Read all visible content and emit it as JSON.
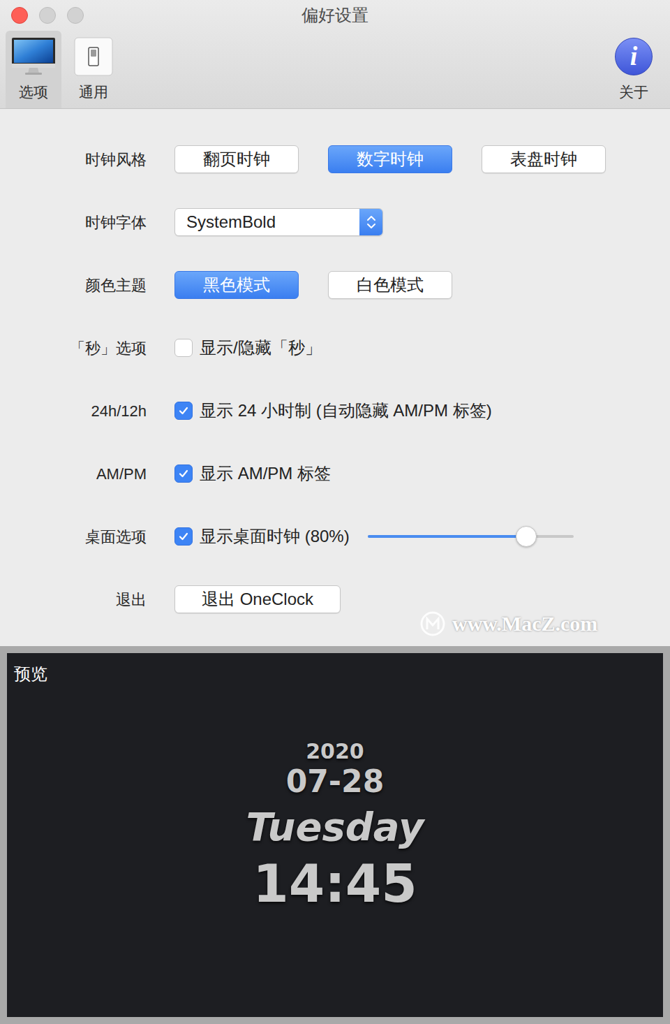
{
  "window": {
    "title": "偏好设置"
  },
  "toolbar": {
    "tabs": [
      {
        "label": "选项",
        "selected": true,
        "kind": "display"
      },
      {
        "label": "通用",
        "selected": false,
        "kind": "switch"
      }
    ],
    "about": {
      "label": "关于",
      "icon": "i"
    }
  },
  "settings": [
    {
      "kind": "segmented",
      "label": "时钟风格",
      "options": [
        {
          "label": "翻页时钟",
          "selected": false
        },
        {
          "label": "数字时钟",
          "selected": true
        },
        {
          "label": "表盘时钟",
          "selected": false
        }
      ]
    },
    {
      "kind": "select",
      "label": "时钟字体",
      "value": "SystemBold"
    },
    {
      "kind": "segmented",
      "label": "颜色主题",
      "options": [
        {
          "label": "黑色模式",
          "selected": true
        },
        {
          "label": "白色模式",
          "selected": false
        }
      ]
    },
    {
      "kind": "checkbox",
      "label": "「秒」选项",
      "text": "显示/隐藏「秒」",
      "checked": false
    },
    {
      "kind": "checkbox",
      "label": "24h/12h",
      "text": "显示 24 小时制 (自动隐藏 AM/PM 标签)",
      "checked": true
    },
    {
      "kind": "checkbox",
      "label": "AM/PM",
      "text": "显示 AM/PM 标签",
      "checked": true
    },
    {
      "kind": "slider",
      "label": "桌面选项",
      "text": "显示桌面时钟 (80%)",
      "checked": true,
      "level": 0.77
    },
    {
      "kind": "button",
      "label": "退出",
      "text": "退出 OneClock"
    }
  ],
  "watermark": "www.MacZ.com",
  "preview": {
    "label": "预览",
    "lines": [
      "2020",
      "07-28",
      "Tuesday",
      "14:45"
    ]
  }
}
